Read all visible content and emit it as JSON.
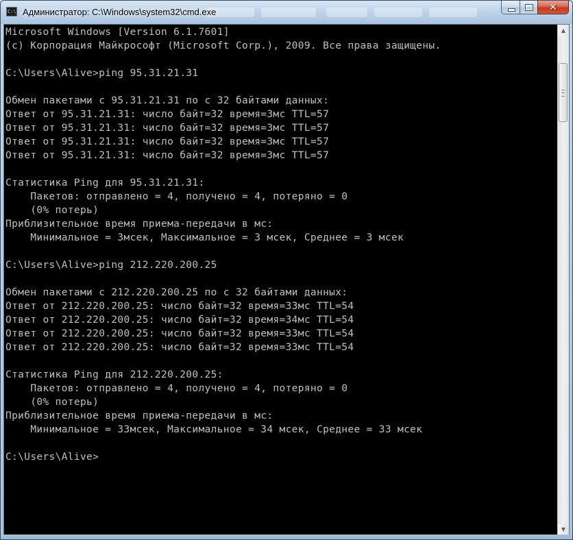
{
  "window": {
    "title": "Администратор: C:\\Windows\\system32\\cmd.exe",
    "icon": "cmd-console-icon",
    "buttons": {
      "minimize_icon": "minimize-icon",
      "maximize_icon": "maximize-icon",
      "close_icon": "close-icon",
      "close_glyph": "✕"
    }
  },
  "console": {
    "background": "#000000",
    "foreground": "#c0c0c0",
    "lines": [
      "Microsoft Windows [Version 6.1.7601]",
      "(c) Корпорация Майкрософт (Microsoft Corp.), 2009. Все права защищены.",
      "",
      "C:\\Users\\Alive>ping 95.31.21.31",
      "",
      "Обмен пакетами с 95.31.21.31 по с 32 байтами данных:",
      "Ответ от 95.31.21.31: число байт=32 время=3мс TTL=57",
      "Ответ от 95.31.21.31: число байт=32 время=3мс TTL=57",
      "Ответ от 95.31.21.31: число байт=32 время=3мс TTL=57",
      "Ответ от 95.31.21.31: число байт=32 время=3мс TTL=57",
      "",
      "Статистика Ping для 95.31.21.31:",
      "    Пакетов: отправлено = 4, получено = 4, потеряно = 0",
      "    (0% потерь)",
      "Приблизительное время приема-передачи в мс:",
      "    Минимальное = 3мсек, Максимальное = 3 мсек, Среднее = 3 мсек",
      "",
      "C:\\Users\\Alive>ping 212.220.200.25",
      "",
      "Обмен пакетами с 212.220.200.25 по с 32 байтами данных:",
      "Ответ от 212.220.200.25: число байт=32 время=33мс TTL=54",
      "Ответ от 212.220.200.25: число байт=32 время=34мс TTL=54",
      "Ответ от 212.220.200.25: число байт=32 время=33мс TTL=54",
      "Ответ от 212.220.200.25: число байт=32 время=33мс TTL=54",
      "",
      "Статистика Ping для 212.220.200.25:",
      "    Пакетов: отправлено = 4, получено = 4, потеряно = 0",
      "    (0% потерь)",
      "Приблизительное время приема-передачи в мс:",
      "    Минимальное = 33мсек, Максимальное = 34 мсек, Среднее = 33 мсек",
      "",
      "C:\\Users\\Alive>"
    ]
  },
  "scrollbar": {
    "up_arrow": "▲",
    "down_arrow": "▼",
    "up_icon": "scroll-up-arrow-icon",
    "down_icon": "scroll-down-arrow-icon"
  }
}
